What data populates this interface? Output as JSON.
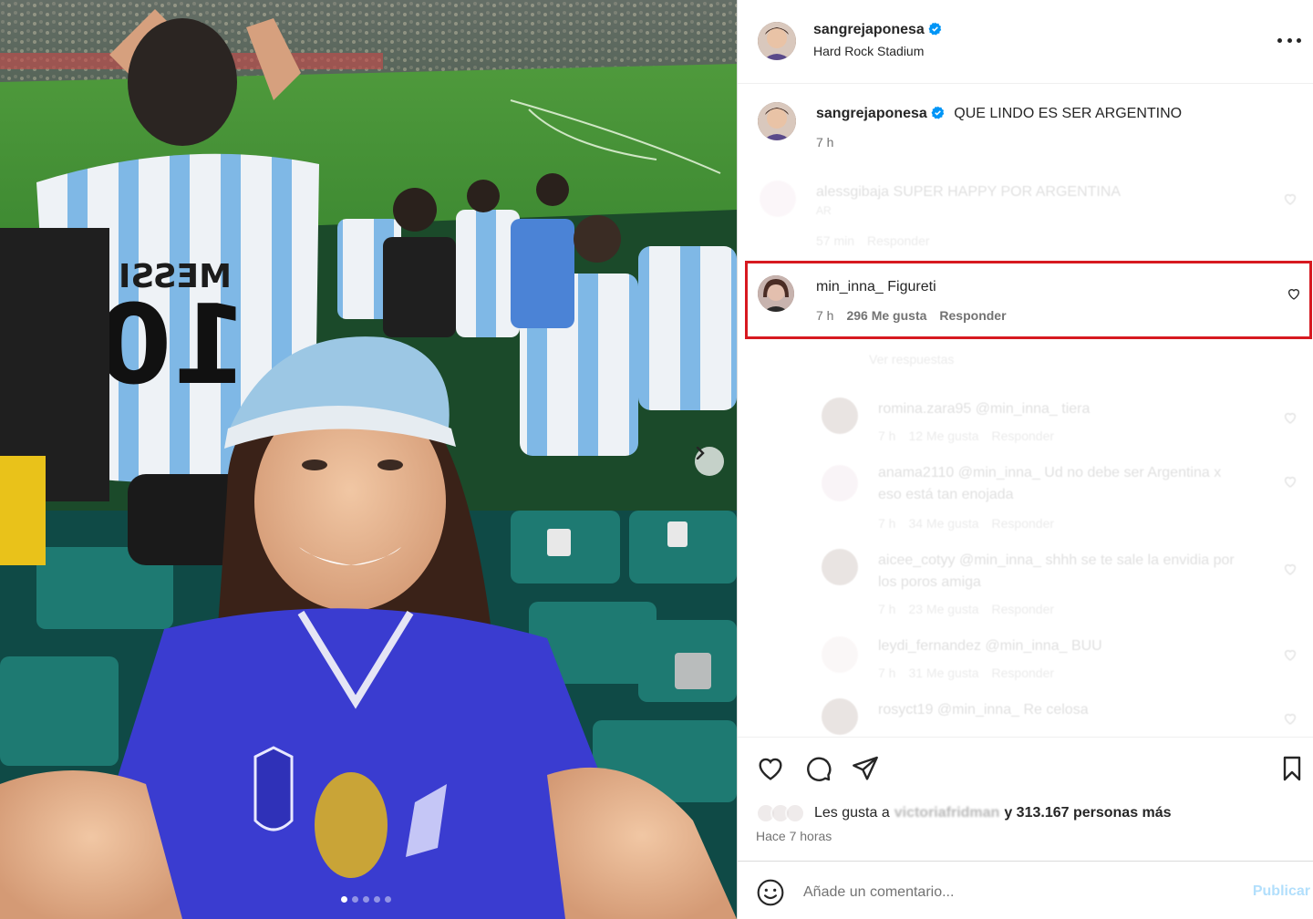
{
  "post": {
    "author": "sangrejaponesa",
    "location": "Hard Rock Stadium",
    "caption_text": "QUE LINDO ES SER ARGENTINO",
    "caption_time": "7 h",
    "jersey_name": "MESSI",
    "jersey_number": "10",
    "carousel": {
      "count": 5,
      "active_index": 0
    }
  },
  "comments": {
    "faded_top": {
      "username": "alessgibaja",
      "text": "SUPER HAPPY POR ARGENTINA",
      "line2": "AR",
      "time": "57 min",
      "reply": "Responder"
    },
    "highlighted": {
      "username": "min_inna_",
      "text": "Figureti",
      "time": "7 h",
      "likes": "296 Me gusta",
      "reply": "Responder"
    },
    "view_replies": "Ver respuestas",
    "replies": [
      {
        "username": "romina.zara95",
        "text": "@min_inna_ tiera",
        "line2": "",
        "time": "7 h",
        "likes": "12 Me gusta",
        "reply": "Responder"
      },
      {
        "username": "anama2110",
        "text": "@min_inna_ Ud no debe ser Argentina x",
        "line2": "eso está tan enojada",
        "time": "7 h",
        "likes": "34 Me gusta",
        "reply": "Responder"
      },
      {
        "username": "aicee_cotyy",
        "text": "@min_inna_ shhh se te sale la envidia por",
        "line2": "los poros amiga",
        "time": "7 h",
        "likes": "23 Me gusta",
        "reply": "Responder"
      },
      {
        "username": "leydi_fernandez",
        "text": "@min_inna_ BUU",
        "line2": "",
        "time": "7 h",
        "likes": "31 Me gusta",
        "reply": "Responder"
      },
      {
        "username": "rosyct19",
        "text": "@min_inna_ Re celosa",
        "line2": "",
        "time": "",
        "likes": "",
        "reply": ""
      }
    ]
  },
  "likes": {
    "prefix": "Les gusta a",
    "first_user": "victoriafridman",
    "suffix": "y 313.167 personas más",
    "posted": "Hace 7 horas"
  },
  "add_comment": {
    "placeholder": "Añade un comentario...",
    "publish": "Publicar"
  },
  "colors": {
    "verified": "#0095f6",
    "highlight_border": "#d71920",
    "publish_disabled": "#b2dffc"
  },
  "icons": [
    "verified-icon",
    "more-icon",
    "heart-icon",
    "comment-icon",
    "share-icon",
    "bookmark-icon",
    "emoji-icon",
    "chevron-right-icon"
  ]
}
